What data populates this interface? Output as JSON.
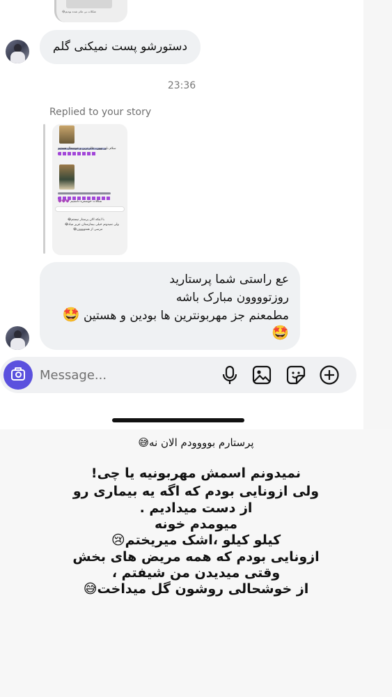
{
  "chat": {
    "story_thumb_caption": "شکلات بی مائز شده بودیم😂",
    "message1": "دستورشو پست نمیکنی گلم",
    "timestamp": "23:36",
    "replied_label": "Replied to your story",
    "story_preview": {
      "line1": "سلام باور نهون، عالی‌ترین و خوشحال هستیم",
      "line2": "شکلات خوشمزه داشتیم 💜💜💜",
      "line3": "با اینکه الان پرستار نیستم😂",
      "line4": "ولی نمیدونم خیلی بیمارستان عزیز میاد😂",
      "line5": "مرسی از همتوووون😂"
    },
    "message2": {
      "line1": "عع راستی شما پرستارید",
      "line2": "روزتوووون مبارک باشه",
      "line3": "مطمعنم جز مهربونترین ها بودین و هستین",
      "emoji1": "🤩",
      "emoji2": "🤩"
    }
  },
  "composer": {
    "placeholder": "Message...",
    "icons": [
      "camera-icon",
      "microphone-icon",
      "gallery-icon",
      "sticker-icon",
      "plus-icon"
    ]
  },
  "story_overlay": {
    "caption": "پرستارم بوووودم الان نه😅",
    "lines": [
      "نمیدونم اسمش مهربونیه یا چی!",
      "ولی ازونایی بودم که اگه یه بیماری رو",
      "از دست میدادیم .",
      "میومدم خونه",
      "کیلو کیلو ،اشک میریختم😢",
      "ازونایی بودم که همه مریض های بخش",
      "وقتی میدیدن  من شیفتم ،",
      "از خوشحالی روشون گل میداخت😅"
    ]
  },
  "colors": {
    "bubble": "#eff1f3",
    "camera_button": "#5b51de",
    "composer_bg": "#f0f1f3"
  }
}
